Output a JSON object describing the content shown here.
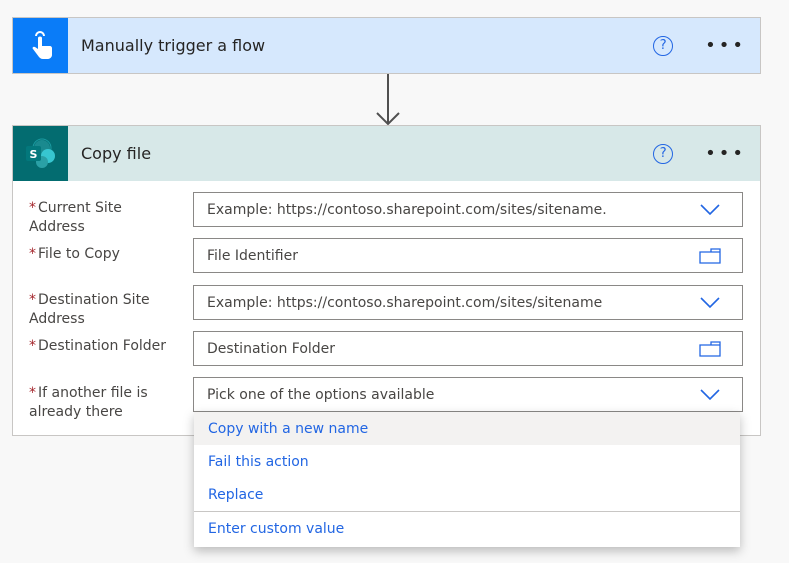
{
  "trigger": {
    "title": "Manually trigger a flow",
    "icon": "touch-hand-icon",
    "help_label": "?",
    "more_label": "•••"
  },
  "action": {
    "title": "Copy file",
    "icon": "sharepoint-icon",
    "help_label": "?",
    "more_label": "•••",
    "fields": [
      {
        "label": "Current Site Address",
        "required": "*",
        "placeholder": "Example: https://contoso.sharepoint.com/sites/sitename.",
        "control": "dropdown"
      },
      {
        "label": "File to Copy",
        "required": "*",
        "placeholder": "File Identifier",
        "control": "folder-picker"
      },
      {
        "label": "Destination Site Address",
        "required": "*",
        "placeholder": "Example: https://contoso.sharepoint.com/sites/sitename",
        "control": "dropdown"
      },
      {
        "label": "Destination Folder",
        "required": "*",
        "placeholder": "Destination Folder",
        "control": "folder-picker"
      },
      {
        "label": "If another file is already there",
        "required": "*",
        "placeholder": "Pick one of the options available",
        "control": "dropdown"
      }
    ]
  },
  "dropdown_menu": {
    "options": [
      "Copy with a new name",
      "Fail this action",
      "Replace"
    ],
    "highlighted": "Copy with a new name",
    "custom_option": "Enter custom value"
  },
  "colors": {
    "trigger_accent": "#0a7cf8",
    "sharepoint_accent": "#036c70",
    "link_blue": "#2266e3",
    "required_red": "#a4262c"
  }
}
